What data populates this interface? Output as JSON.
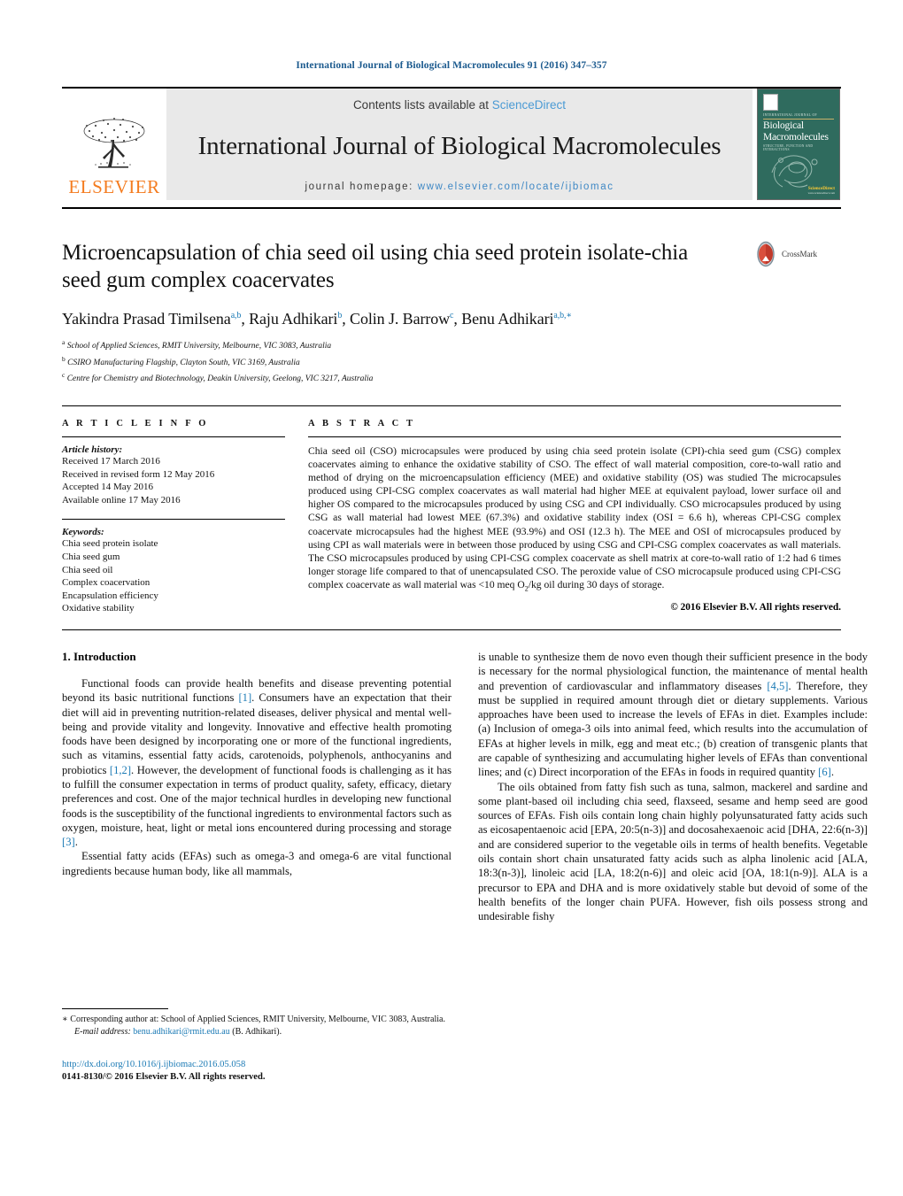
{
  "running_head": "International Journal of Biological Macromolecules 91 (2016) 347–357",
  "masthead": {
    "contents_prefix": "Contents lists available at ",
    "sciencedirect": "ScienceDirect",
    "journal_name": "International Journal of Biological Macromolecules",
    "homepage_prefix": "journal homepage: ",
    "homepage_url": "www.elsevier.com/locate/ijbiomac",
    "publisher": "ELSEVIER",
    "cover": {
      "kicker": "INTERNATIONAL JOURNAL OF",
      "title_line1": "Biological",
      "title_line2": "Macromolecules",
      "subtitle": "STRUCTURE, FUNCTION AND INTERACTIONS",
      "footer_label": "ScienceDirect",
      "footer_small": "www.sciencedirect.com"
    },
    "colors": {
      "accent_blue": "#3f88c5",
      "elsevier_orange": "#f47c20",
      "band_gray": "#e9e9e9",
      "cover_green": "#2f6b5e"
    }
  },
  "title_area": {
    "title": "Microencapsulation of chia seed oil using chia seed protein isolate-chia seed gum complex coacervates",
    "crossmark_label": "CrossMark",
    "authors": [
      {
        "name": "Yakindra Prasad Timilsena",
        "sup": "a,b",
        "sep": ", "
      },
      {
        "name": "Raju Adhikari",
        "sup": "b",
        "sep": ", "
      },
      {
        "name": "Colin J. Barrow",
        "sup": "c",
        "sep": ", "
      },
      {
        "name": "Benu Adhikari",
        "sup": "a,b,∗",
        "sep": ""
      }
    ],
    "affiliations": [
      {
        "sup": "a",
        "text": "School of Applied Sciences, RMIT University, Melbourne, VIC 3083, Australia"
      },
      {
        "sup": "b",
        "text": "CSIRO Manufacturing Flagship, Clayton South, VIC 3169, Australia"
      },
      {
        "sup": "c",
        "text": "Centre for Chemistry and Biotechnology, Deakin University, Geelong, VIC 3217, Australia"
      }
    ]
  },
  "article_info": {
    "heading": "A R T I C L E   I N F O",
    "history_label": "Article history:",
    "history": [
      "Received 17 March 2016",
      "Received in revised form 12 May 2016",
      "Accepted 14 May 2016",
      "Available online 17 May 2016"
    ],
    "keywords_label": "Keywords:",
    "keywords": [
      "Chia seed protein isolate",
      "Chia seed gum",
      "Chia seed oil",
      "Complex coacervation",
      "Encapsulation efficiency",
      "Oxidative stability"
    ]
  },
  "abstract": {
    "heading": "A B S T R A C T",
    "body_part1": "Chia seed oil (CSO) microcapsules were produced by using chia seed protein isolate (CPI)-chia seed gum (CSG) complex coacervates aiming to enhance the oxidative stability of CSO. The effect of wall material composition, core-to-wall ratio and method of drying on the microencapsulation efficiency (MEE) and oxidative stability (OS) was studied The microcapsules produced using CPI-CSG complex coacervates as wall material had higher MEE at equivalent payload, lower surface oil and higher OS compared to the microcapsules produced by using CSG and CPI individually. CSO microcapsules produced by using CSG as wall material had lowest MEE (67.3%) and oxidative stability index (OSI = 6.6 h), whereas CPI-CSG complex coacervate microcapsules had the highest MEE (93.9%) and OSI (12.3 h). The MEE and OSI of microcapsules produced by using CPI as wall materials were in between those produced by using CSG and CPI-CSG complex coacervates as wall materials. The CSO microcapsules produced by using CPI-CSG complex coacervate as shell matrix at core-to-wall ratio of 1:2 had 6 times longer storage life compared to that of unencapsulated CSO. The peroxide value of CSO microcapsule produced using CPI-CSG complex coacervate as wall material was <10 meq O",
    "body_sub": "2",
    "body_part2": "/kg oil during 30 days of storage.",
    "copyright": "© 2016 Elsevier B.V. All rights reserved."
  },
  "introduction": {
    "section_number_title": "1.  Introduction",
    "left_para1_a": "Functional foods can provide health benefits and disease preventing potential beyond its basic nutritional functions ",
    "left_para1_ref1": "[1]",
    "left_para1_b": ". Consumers have an expectation that their diet will aid in preventing nutrition-related diseases, deliver physical and mental well-being and provide vitality and longevity. Innovative and effective health promoting foods have been designed by incorporating one or more of the functional ingredients, such as vitamins, essential fatty acids, carotenoids, polyphenols, anthocyanins and probiotics ",
    "left_para1_ref2": "[1,2]",
    "left_para1_c": ". However, the development of functional foods is challenging as it has to fulfill the consumer expectation in terms of product quality, safety, efficacy, dietary preferences and cost. One of the major technical hurdles in developing new functional foods is the susceptibility of the functional ingredients to environmental factors such as oxygen, moisture, heat, light or metal ions encountered during processing and storage ",
    "left_para1_ref3": "[3]",
    "left_para1_d": ".",
    "left_para2": "Essential fatty acids (EFAs) such as omega-3 and omega-6 are vital functional ingredients because human body, like all mammals,",
    "right_para1_a": "is unable to synthesize them de novo even though their sufficient presence in the body is necessary for the normal physiological function, the maintenance of mental health and prevention of cardiovascular and inflammatory diseases ",
    "right_para1_ref1": "[4,5]",
    "right_para1_b": ". Therefore, they must be supplied in required amount through diet or dietary supplements. Various approaches have been used to increase the levels of EFAs in diet. Examples include: (a) Inclusion of omega-3 oils into animal feed, which results into the accumulation of EFAs at higher levels in milk, egg and meat etc.; (b) creation of transgenic plants that are capable of synthesizing and accumulating higher levels of EFAs than conventional lines; and (c) Direct incorporation of the EFAs in foods in required quantity ",
    "right_para1_ref2": "[6]",
    "right_para1_c": ".",
    "right_para2": "The oils obtained from fatty fish such as tuna, salmon, mackerel and sardine and some plant-based oil including chia seed, flaxseed, sesame and hemp seed are good sources of EFAs. Fish oils contain long chain highly polyunsaturated fatty acids such as eicosapentaenoic acid [EPA, 20:5(n-3)] and docosahexaenoic acid [DHA, 22:6(n-3)] and are considered superior to the vegetable oils in terms of health benefits. Vegetable oils contain short chain unsaturated fatty acids such as alpha linolenic acid [ALA, 18:3(n-3)], linoleic acid [LA, 18:2(n-6)] and oleic acid [OA, 18:1(n-9)]. ALA is a precursor to EPA and DHA and is more oxidatively stable but devoid of some of the health benefits of the longer chain PUFA. However, fish oils possess strong and undesirable fishy"
  },
  "footer": {
    "corr_marker": "∗",
    "corr_text": " Corresponding author at: School of Applied Sciences, RMIT University, Melbourne, VIC 3083, Australia.",
    "email_label": "E-mail address:",
    "email": "benu.adhikari@rmit.edu.au",
    "email_suffix": " (B. Adhikari).",
    "doi": "http://dx.doi.org/10.1016/j.ijbiomac.2016.05.058",
    "issn_line": "0141-8130/© 2016 Elsevier B.V. All rights reserved."
  }
}
